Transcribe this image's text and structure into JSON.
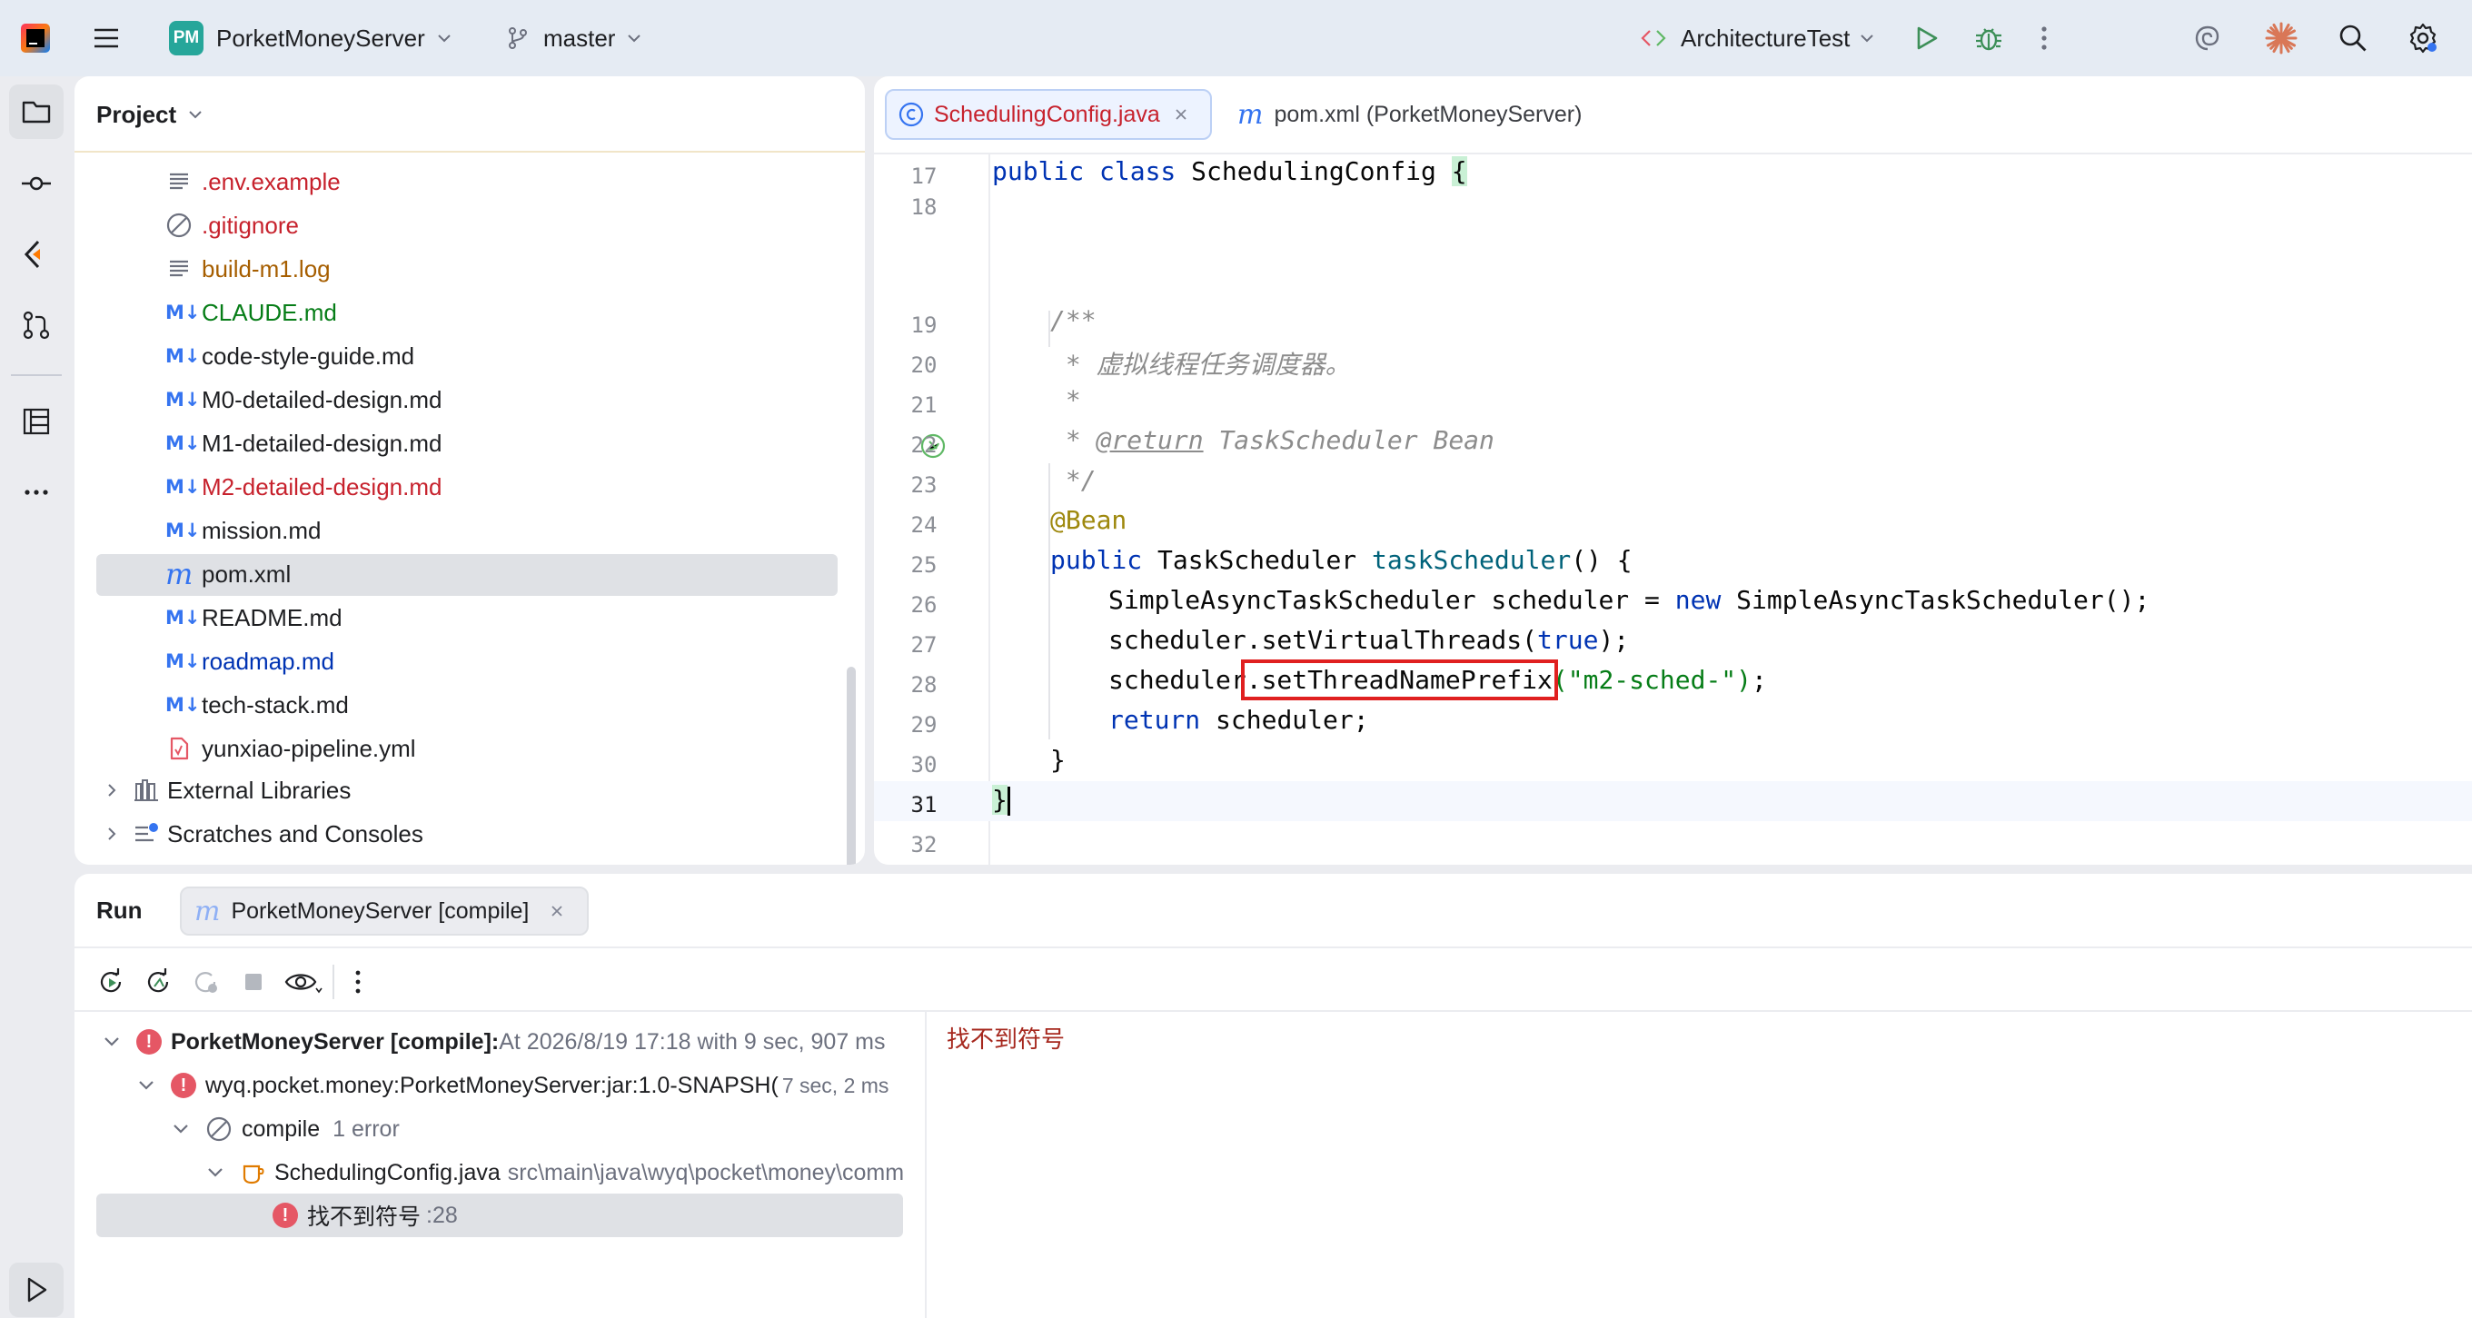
{
  "titlebar": {
    "project_initials": "PM",
    "project_name": "PorketMoneyServer",
    "branch": "master",
    "run_config": "ArchitectureTest"
  },
  "project_panel": {
    "title": "Project",
    "files": [
      {
        "name": ".env.example",
        "icon": "text-file-icon",
        "color": "#c7222d"
      },
      {
        "name": ".gitignore",
        "icon": "ignore-file-icon",
        "color": "#c7222d"
      },
      {
        "name": "build-m1.log",
        "icon": "text-file-icon",
        "color": "#a65e00"
      },
      {
        "name": "CLAUDE.md",
        "icon": "markdown-icon",
        "color": "#067d17"
      },
      {
        "name": "code-style-guide.md",
        "icon": "markdown-icon",
        "color": "#1e1f22"
      },
      {
        "name": "M0-detailed-design.md",
        "icon": "markdown-icon",
        "color": "#1e1f22"
      },
      {
        "name": "M1-detailed-design.md",
        "icon": "markdown-icon",
        "color": "#1e1f22"
      },
      {
        "name": "M2-detailed-design.md",
        "icon": "markdown-icon",
        "color": "#c7222d"
      },
      {
        "name": "mission.md",
        "icon": "markdown-icon",
        "color": "#1e1f22"
      },
      {
        "name": "pom.xml",
        "icon": "maven-icon",
        "color": "#1e1f22",
        "selected": true
      },
      {
        "name": "README.md",
        "icon": "markdown-icon",
        "color": "#1e1f22"
      },
      {
        "name": "roadmap.md",
        "icon": "markdown-icon",
        "color": "#0033b3"
      },
      {
        "name": "tech-stack.md",
        "icon": "markdown-icon",
        "color": "#1e1f22"
      },
      {
        "name": "yunxiao-pipeline.yml",
        "icon": "yaml-icon",
        "color": "#1e1f22"
      }
    ],
    "external_libraries": "External Libraries",
    "scratches": "Scratches and Consoles"
  },
  "editor": {
    "tabs": [
      {
        "label": "SchedulingConfig.java",
        "active": true
      },
      {
        "label": "pom.xml (PorketMoneyServer)",
        "active": false
      }
    ],
    "line_numbers": [
      "17",
      "18",
      "19",
      "20",
      "21",
      "22",
      "23",
      "24",
      "25",
      "26",
      "27",
      "28",
      "29",
      "30",
      "31",
      "32"
    ],
    "code": {
      "l17_kw": "public class",
      "l17_name": " SchedulingConfig ",
      "l17_brace": "{",
      "l19": "/**",
      "l20": " * 虚拟线程任务调度器。",
      "l21": " *",
      "l22_pre": " * ",
      "l22_tag": "@return",
      "l22_rest": " TaskScheduler Bean",
      "l23": " */",
      "l24": "@Bean",
      "l25_kw": "public",
      "l25_type": " TaskScheduler ",
      "l25_fn": "taskScheduler",
      "l25_rest": "() {",
      "l26_a": "SimpleAsyncTaskScheduler scheduler = ",
      "l26_kw": "new",
      "l26_b": " SimpleAsyncTaskScheduler();",
      "l27_a": "scheduler.setVirtualThreads(",
      "l27_kw": "true",
      "l27_b": ");",
      "l28_a": "scheduler",
      "l28_m": ".setThreadNamePrefix",
      "l28_s": "(\"m2-sched-\")",
      "l28_b": ";",
      "l29_kw": "return",
      "l29_b": " scheduler;",
      "l30": "}",
      "l31": "}"
    }
  },
  "run_panel": {
    "title": "Run",
    "tab_label": "PorketMoneyServer [compile]",
    "tree": {
      "root_label": "PorketMoneyServer [compile]:",
      "root_detail": " At 2026/8/19 17:18 with 9 sec, 907 ms",
      "module_label": "wyq.pocket.money:PorketMoneyServer:jar:1.0-SNAPSH(",
      "module_time": "7 sec, 2 ms",
      "goal_label": "compile",
      "goal_count": "1 error",
      "file_label": "SchedulingConfig.java",
      "file_path": "src\\main\\java\\wyq\\pocket\\money\\comm",
      "error_label": "找不到符号",
      "error_line": ":28"
    },
    "output_message": "找不到符号"
  },
  "colors": {
    "accent": "#3574f0",
    "error": "#e55765",
    "highlight_box": "#e02020",
    "selection": "#dfe1e5"
  }
}
